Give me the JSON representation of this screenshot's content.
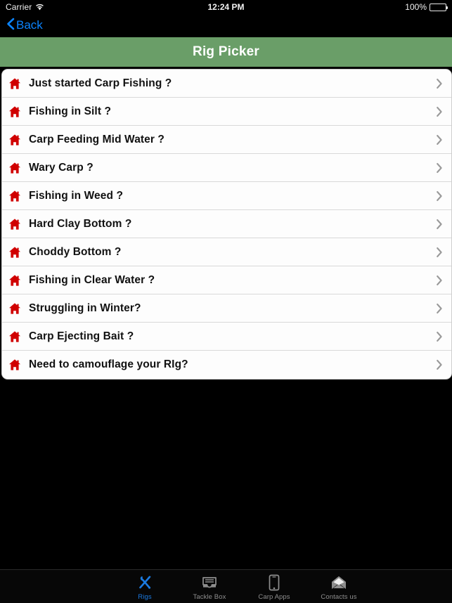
{
  "statusbar": {
    "carrier": "Carrier",
    "wifi_icon": "wifi-icon",
    "time": "12:24 PM",
    "battery_percent": "100%",
    "battery_icon": "battery-full-icon"
  },
  "navbar": {
    "back_label": "Back",
    "back_icon": "chevron-left-icon",
    "back_color": "#0b84ff"
  },
  "header": {
    "title": "Rig Picker",
    "background_color": "#6a9e68",
    "text_color": "#ffffff"
  },
  "list": {
    "row_icon": "home-icon",
    "row_icon_color": "#d00000",
    "disclosure_icon": "chevron-right-icon",
    "rows": [
      {
        "label": "Just started Carp Fishing ?"
      },
      {
        "label": "Fishing in Silt ?"
      },
      {
        "label": "Carp Feeding Mid Water ?"
      },
      {
        "label": "Wary Carp ?"
      },
      {
        "label": "Fishing in Weed ?"
      },
      {
        "label": "Hard Clay Bottom ?"
      },
      {
        "label": "Choddy Bottom ?"
      },
      {
        "label": "Fishing in Clear Water ?"
      },
      {
        "label": "Struggling in Winter?"
      },
      {
        "label": "Carp Ejecting Bait ?"
      },
      {
        "label": "Need to camouflage your RIg?"
      }
    ]
  },
  "tabbar": {
    "active_color": "#1b7ae0",
    "inactive_color": "#8e8e8e",
    "tabs": [
      {
        "label": "Rigs",
        "icon": "tools-icon",
        "active": true
      },
      {
        "label": "Tackle Box",
        "icon": "tray-icon",
        "active": false
      },
      {
        "label": "Carp Apps",
        "icon": "phone-icon",
        "active": false
      },
      {
        "label": "Contacts us",
        "icon": "envelope-icon",
        "active": false
      }
    ]
  }
}
